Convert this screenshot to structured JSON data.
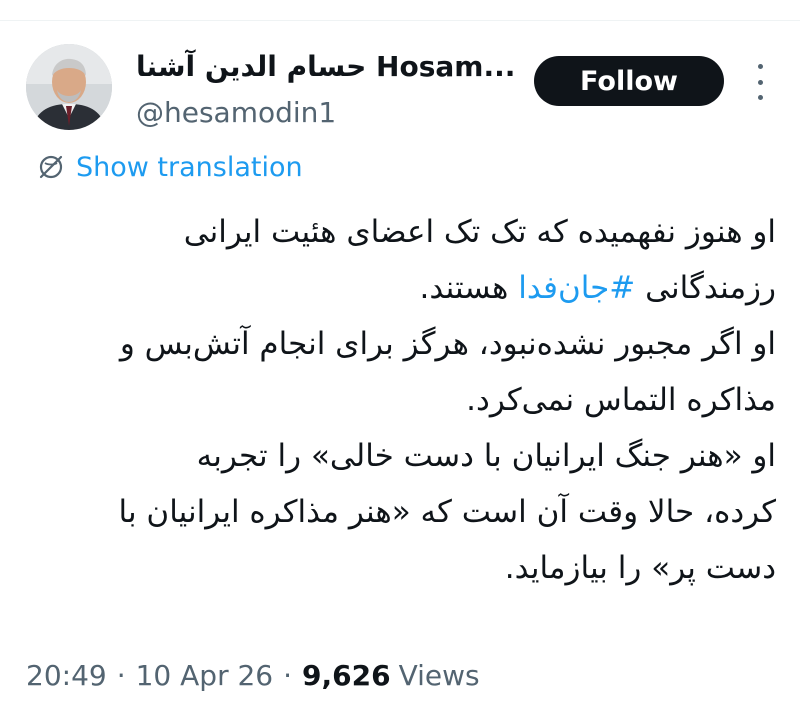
{
  "author": {
    "display_name_rtl": "حسام الدين آشنا",
    "display_name_ltr": "Hosam...",
    "handle": "@hesamodin1"
  },
  "actions": {
    "follow_label": "Follow",
    "more_icon": "more-horizontal-dots"
  },
  "translation": {
    "icon": "globe-translate-icon",
    "label": "Show translation"
  },
  "tweet": {
    "lines_before_hashtag": "او هنوز نفهمیده که تک تک اعضای هئیت ایرانی\nرزمندگانی ",
    "hashtag": "#جان‌فدا",
    "lines_after_hashtag": " هستند.\nاو اگر مجبور نشده‌نبود، هرگز برای انجام آتش‌بس و\nمذاکره التماس نمی‌کرد.\nاو «هنر جنگ ایرانیان با دست خالی» را تجربه\nکرده، حالا وقت آن است که «هنر مذاکره ایرانیان با\nدست پر» را بیازماید."
  },
  "meta": {
    "time": "20:49",
    "separator": "·",
    "date": "10 Apr 26",
    "views_count": "9,626",
    "views_label": "Views"
  },
  "colors": {
    "link_blue": "#1d9bf0",
    "text_primary": "#0f1419",
    "text_secondary": "#536471",
    "button_dark": "#0f1419"
  }
}
